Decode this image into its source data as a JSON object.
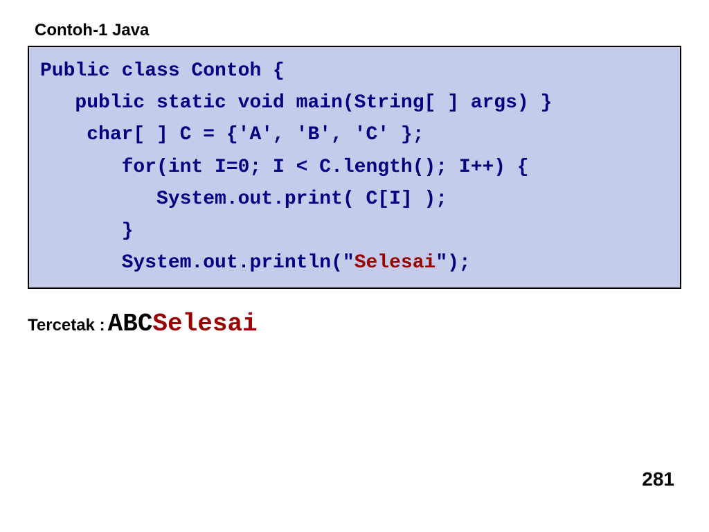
{
  "title": "Contoh-1  Java",
  "code": {
    "line1": "Public class Contoh {",
    "line2": "   public static void main(String[ ] args) }",
    "line3": "    char[ ] C = {'A', 'B', 'C' };",
    "line4": "       for(int I=0; I < C.length(); I++) {",
    "line5": "          System.out.print( C[I] );",
    "line6": "       }",
    "line7_prefix": "       System.out.println(\"",
    "line7_highlight": "Selesai",
    "line7_suffix": "\");"
  },
  "output": {
    "label": "Tercetak :",
    "abc": "ABC",
    "selesai": "Selesai"
  },
  "page_number": "281"
}
